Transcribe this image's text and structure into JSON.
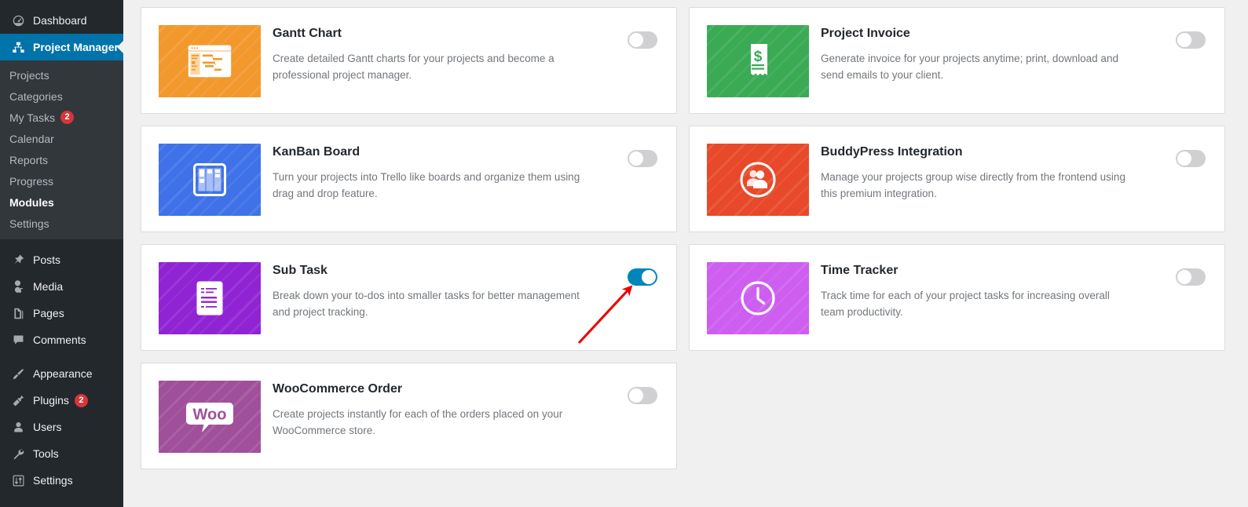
{
  "sidebar": {
    "top_items": [
      {
        "label": "Dashboard",
        "icon": "dashboard-icon",
        "active": false
      }
    ],
    "active_item": {
      "label": "Project Manager",
      "icon": "project-manager-icon"
    },
    "submenu": [
      {
        "label": "Projects",
        "current": false
      },
      {
        "label": "Categories",
        "current": false
      },
      {
        "label": "My Tasks",
        "current": false,
        "badge": "2"
      },
      {
        "label": "Calendar",
        "current": false
      },
      {
        "label": "Reports",
        "current": false
      },
      {
        "label": "Progress",
        "current": false
      },
      {
        "label": "Modules",
        "current": true
      },
      {
        "label": "Settings",
        "current": false
      }
    ],
    "bottom_items": [
      {
        "label": "Posts",
        "icon": "pin-icon"
      },
      {
        "label": "Media",
        "icon": "media-icon"
      },
      {
        "label": "Pages",
        "icon": "pages-icon"
      },
      {
        "label": "Comments",
        "icon": "comment-icon"
      },
      {
        "label": "Appearance",
        "icon": "brush-icon"
      },
      {
        "label": "Plugins",
        "icon": "plugin-icon",
        "badge": "2"
      },
      {
        "label": "Users",
        "icon": "user-icon"
      },
      {
        "label": "Tools",
        "icon": "wrench-icon"
      },
      {
        "label": "Settings",
        "icon": "sliders-icon"
      }
    ]
  },
  "modules": [
    {
      "title": "Gantt Chart",
      "description": "Create detailed Gantt charts for your projects and become a professional project manager.",
      "icon": "gantt-chart-icon",
      "color": "#f3982c",
      "enabled": false,
      "toggle_state": "off"
    },
    {
      "title": "Project Invoice",
      "description": "Generate invoice for your projects anytime; print, download and send emails to your client.",
      "icon": "invoice-receipt-icon",
      "color": "#3aaa55",
      "enabled": false,
      "toggle_state": "off"
    },
    {
      "title": "KanBan Board",
      "description": "Turn your projects into Trello like boards and organize them using drag and drop feature.",
      "icon": "kanban-board-icon",
      "color": "#3f72e8",
      "enabled": false,
      "toggle_state": "off"
    },
    {
      "title": "BuddyPress Integration",
      "description": "Manage your projects group wise directly from the frontend using this premium integration.",
      "icon": "buddypress-people-icon",
      "color": "#e8492a",
      "enabled": false,
      "toggle_state": "off"
    },
    {
      "title": "Sub Task",
      "description": "Break down your to-dos into smaller tasks for better management and project tracking.",
      "icon": "sub-task-list-icon",
      "color": "#9024d4",
      "enabled": true,
      "toggle_state": "on"
    },
    {
      "title": "Time Tracker",
      "description": "Track time for each of your project tasks for increasing overall team productivity.",
      "icon": "clock-icon",
      "color": "#d濃"
    },
    {
      "title": "WooCommerce Order",
      "description": "Create projects instantly for each of the orders placed on your WooCommerce store.",
      "icon": "woocommerce-icon",
      "color": "#a0509a",
      "enabled": false,
      "toggle_state": "off"
    }
  ],
  "colors": {
    "sidebar_bg": "#23282d",
    "submenu_bg": "#32373c",
    "active_blue": "#0073aa",
    "toggle_on": "#0085ba",
    "toggle_off": "#d0d0d2",
    "page_bg": "#f0f0f1",
    "card_bg": "#ffffff",
    "badge_red": "#d63638",
    "annotation_red": "#ee0000"
  },
  "annotation": {
    "type": "arrow",
    "points_to": "sub-task-toggle",
    "color": "#ee0000"
  }
}
